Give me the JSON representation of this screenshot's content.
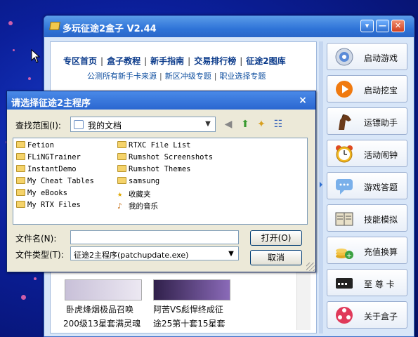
{
  "app": {
    "title": "多玩征途2盒子 V2.44",
    "nav_primary": [
      "专区首页",
      "盒子教程",
      "新手指南",
      "交易排行榜",
      "征途2图库"
    ],
    "nav_secondary": [
      "公测所有新手卡来源",
      "新区冲级专题",
      "职业选择专题"
    ],
    "articles": [
      {
        "line1": "卧虎烽烟极品召唤",
        "line2": "200级13星套满灵魂"
      },
      {
        "line1": "阿苦VS彪悍终成征",
        "line2": "途25第十套15星套"
      }
    ]
  },
  "sidebar": [
    {
      "label": "启动游戏",
      "icon": "gear-icon"
    },
    {
      "label": "启动挖宝",
      "icon": "play-icon"
    },
    {
      "label": "运镖助手",
      "icon": "horse-icon"
    },
    {
      "label": "活动闹钟",
      "icon": "alarm-clock-icon"
    },
    {
      "label": "游戏答题",
      "icon": "chat-bubble-icon"
    },
    {
      "label": "技能模拟",
      "icon": "book-icon"
    },
    {
      "label": "充值换算",
      "icon": "coins-icon"
    },
    {
      "label": "至 尊 卡",
      "icon": "card-icon"
    },
    {
      "label": "关于盒子",
      "icon": "about-icon"
    }
  ],
  "dialog": {
    "title": "请选择征途2主程序",
    "look_in_label": "查找范围(I):",
    "look_in_value": "我的文档",
    "files_col1": [
      "Fetion",
      "FLiNGTrainer",
      "InstantDemo",
      "My Cheat Tables",
      "My eBooks",
      "My RTX Files"
    ],
    "files_col2": [
      "RTXC File List",
      "Rumshot Screenshots",
      "Rumshot Themes",
      "samsung",
      "收藏夹",
      "我的音乐"
    ],
    "filename_label": "文件名(N):",
    "filename_value": "",
    "filetype_label": "文件类型(T):",
    "filetype_value": "征途2主程序(patchupdate.exe)",
    "open_button": "打开(O)",
    "cancel_button": "取消",
    "close_glyph": "×"
  },
  "colors": {
    "accent": "#2f6fd0",
    "window_bg": "#d8e6f8",
    "dialog_bg": "#ece9d8"
  }
}
